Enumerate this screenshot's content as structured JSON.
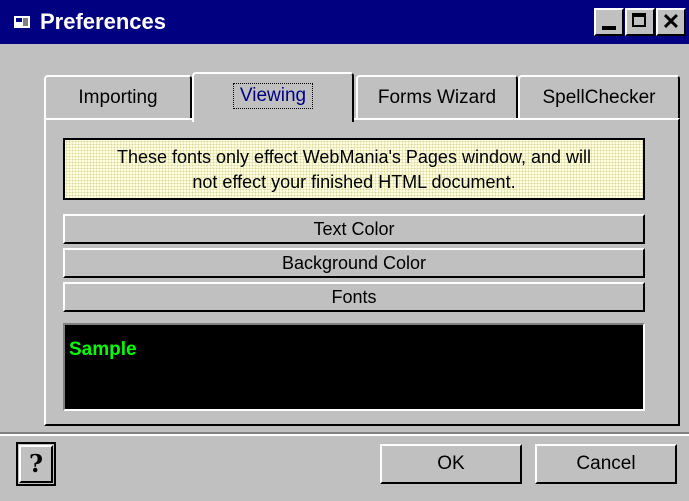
{
  "window": {
    "title": "Preferences",
    "colors": {
      "titlebar": "#000080",
      "face": "#c0c0c0"
    }
  },
  "tabs": [
    {
      "label": "Importing",
      "active": false
    },
    {
      "label": "Viewing",
      "active": true
    },
    {
      "label": "Forms Wizard",
      "active": false
    },
    {
      "label": "SpellChecker",
      "active": false
    }
  ],
  "panel": {
    "note_line1": "These fonts only effect WebMania's Pages window, and will",
    "note_line2": "not effect your finished HTML document.",
    "buttons": {
      "text_color": "Text Color",
      "background_color": "Background Color",
      "fonts": "Fonts"
    },
    "sample": {
      "text": "Sample",
      "text_color": "#00ff00",
      "background_color": "#000000"
    }
  },
  "footer": {
    "help_icon": "question-mark-icon",
    "ok_label": "OK",
    "cancel_label": "Cancel"
  }
}
